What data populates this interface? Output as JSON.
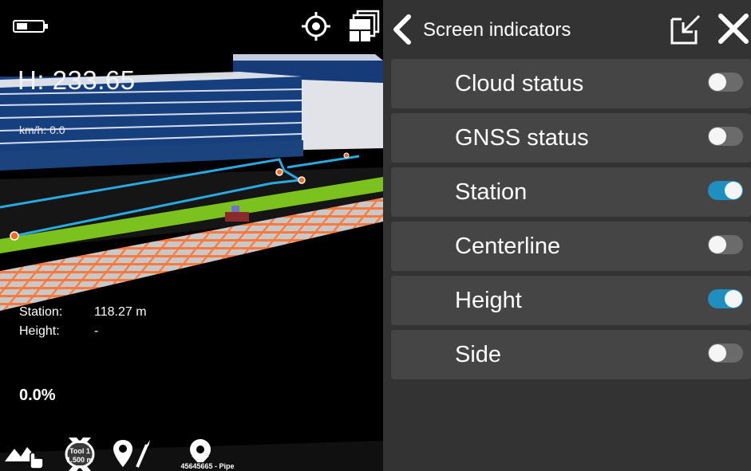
{
  "viewport": {
    "height_readout": "H: 233.65",
    "speed_readout": "km/h: 0.0",
    "station_label": "Station:",
    "station_value": "118.27 m",
    "height_label": "Height:",
    "height_value": "-",
    "progress_readout": "0.0%",
    "tool_name": "Tool 1",
    "tool_size": "1.500 m",
    "pipe_label": "45645665 - Pipe"
  },
  "panel": {
    "title": "Screen indicators",
    "items": [
      {
        "label": "Cloud status",
        "enabled": false
      },
      {
        "label": "GNSS status",
        "enabled": false
      },
      {
        "label": "Station",
        "enabled": true
      },
      {
        "label": "Centerline",
        "enabled": false
      },
      {
        "label": "Height",
        "enabled": true
      },
      {
        "label": "Side",
        "enabled": false
      }
    ]
  },
  "colors": {
    "toggle_on": "#1f8fbf",
    "toggle_off": "#6b6b6b",
    "panel_bg": "#333333",
    "row_bg": "#454545",
    "route_line": "#2aa8e0",
    "ground_strip": "#7cc21e",
    "rail_grid": "#ff7a3c"
  },
  "icons": {
    "battery": "battery-icon",
    "target": "target-icon",
    "layers": "layers-icon",
    "back": "chevron-left-icon",
    "minimize": "minimize-icon",
    "close": "close-icon",
    "terrain": "terrain-icon",
    "tool": "tool-icon",
    "route": "route-icon",
    "pipe": "pipe-icon"
  }
}
